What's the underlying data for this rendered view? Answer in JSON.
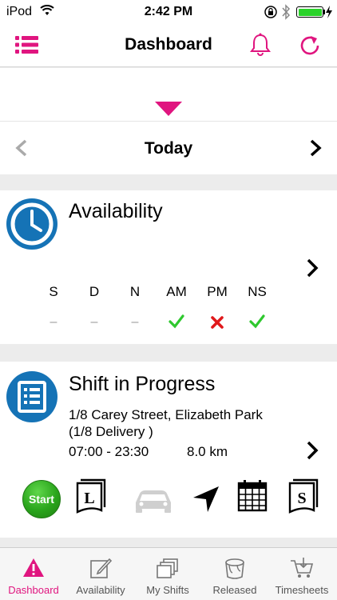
{
  "status_bar": {
    "carrier": "iPod",
    "time": "2:42 PM"
  },
  "header": {
    "title": "Dashboard"
  },
  "date_nav": {
    "label": "Today"
  },
  "availability": {
    "title": "Availability",
    "columns": [
      {
        "label": "S",
        "value": "–",
        "state": "none"
      },
      {
        "label": "D",
        "value": "–",
        "state": "none"
      },
      {
        "label": "N",
        "value": "–",
        "state": "none"
      },
      {
        "label": "AM",
        "value": "✓",
        "state": "yes"
      },
      {
        "label": "PM",
        "value": "✖",
        "state": "no"
      },
      {
        "label": "NS",
        "value": "✓",
        "state": "yes"
      }
    ]
  },
  "shift": {
    "title": "Shift in Progress",
    "address_line1": "1/8 Carey Street, Elizabeth Park",
    "address_line2": "(1/8 Delivery )",
    "time_range": "07:00 - 23:30",
    "distance": "8.0 km",
    "start_label": "Start",
    "doc_l_letter": "L",
    "doc_s_letter": "S"
  },
  "tabs": [
    {
      "label": "Dashboard",
      "icon": "warning-icon",
      "active": true
    },
    {
      "label": "Availability",
      "icon": "edit-icon",
      "active": false
    },
    {
      "label": "My Shifts",
      "icon": "copy-icon",
      "active": false
    },
    {
      "label": "Released",
      "icon": "bucket-icon",
      "active": false
    },
    {
      "label": "Timesheets",
      "icon": "cart-icon",
      "active": false
    }
  ],
  "colors": {
    "accent": "#e0157f",
    "icon_blue": "#1573b6",
    "check_green": "#2ec82e",
    "cross_red": "#e0191b",
    "start_green": "#2aa51c"
  }
}
